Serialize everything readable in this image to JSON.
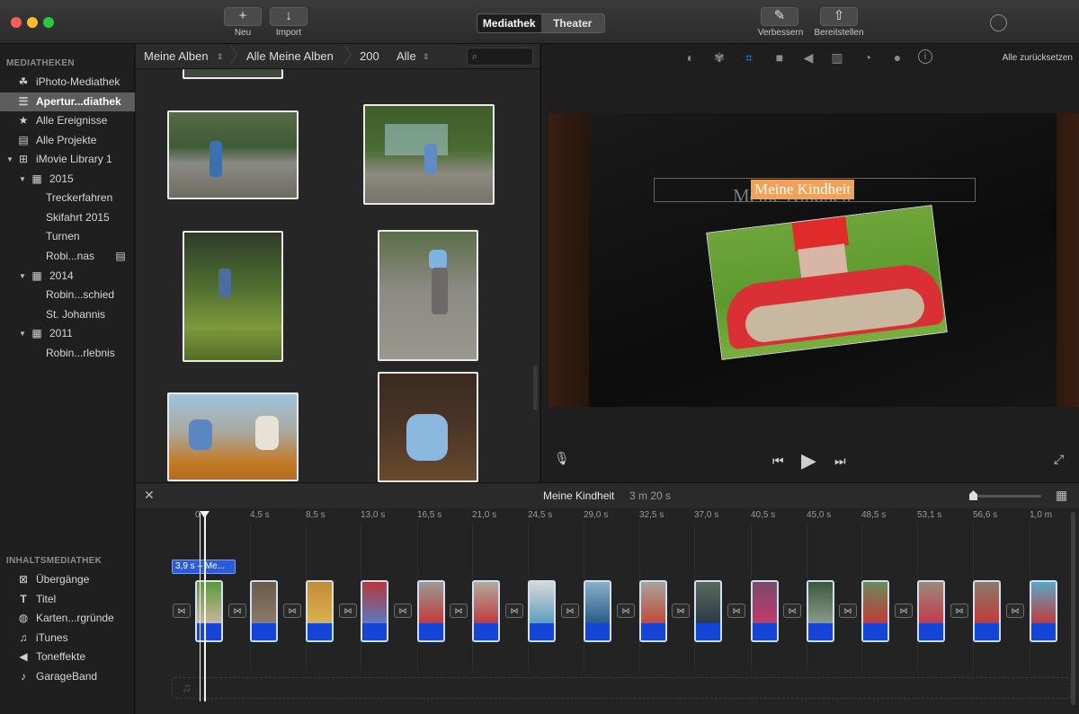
{
  "toolbar": {
    "new_label": "Neu",
    "import_label": "Import",
    "tabs": [
      "Mediathek",
      "Theater"
    ],
    "enhance_label": "Verbessern",
    "share_label": "Bereitstellen"
  },
  "sidebar": {
    "libraries_header": "MEDIATHEKEN",
    "items": [
      {
        "label": "iPhoto-Mediathek",
        "icon": "palm-tree-icon"
      },
      {
        "label": "Apertur...diathek",
        "icon": "aperture-library-icon"
      },
      {
        "label": "Alle Ereignisse",
        "icon": "star-icon"
      },
      {
        "label": "Alle Projekte",
        "icon": "clapperboard-icon"
      },
      {
        "label": "iMovie Library 1",
        "icon": "grid-icon"
      },
      {
        "label": "2015",
        "icon": "calendar-icon"
      },
      {
        "label": "Treckerfahren"
      },
      {
        "label": "Skifahrt 2015"
      },
      {
        "label": "Turnen"
      },
      {
        "label": "Robi...nas",
        "icon": "clapperboard-icon"
      },
      {
        "label": "2014",
        "icon": "calendar-icon"
      },
      {
        "label": "Robin...schied"
      },
      {
        "label": "St. Johannis"
      },
      {
        "label": "2011",
        "icon": "calendar-icon"
      },
      {
        "label": "Robin...rlebnis"
      }
    ],
    "content_header": "INHALTSMEDIATHEK",
    "content_items": [
      {
        "label": "Übergänge",
        "icon": "transitions-icon"
      },
      {
        "label": "Titel",
        "icon": "title-t-icon"
      },
      {
        "label": "Karten...rgründe",
        "icon": "globe-icon"
      },
      {
        "label": "iTunes",
        "icon": "music-note-icon"
      },
      {
        "label": "Toneffekte",
        "icon": "speaker-icon"
      },
      {
        "label": "GarageBand",
        "icon": "guitar-icon"
      }
    ]
  },
  "browser": {
    "crumb1": "Meine Alben",
    "crumb2": "Alle Meine Alben",
    "crumb3": "200",
    "filter": "Alle"
  },
  "viewer": {
    "reset_all": "Alle zurücksetzen",
    "title_text": "Meine Kindheit",
    "title_ghost": "Meine Kindheit"
  },
  "timeline": {
    "project_name": "Meine Kindheit",
    "duration": "3 m 20 s",
    "clip_tag": "3,9 s – Me...",
    "ticks": [
      "0",
      "4,5 s",
      "8,5 s",
      "13,0 s",
      "16,5 s",
      "21,0 s",
      "24,5 s",
      "29,0 s",
      "32,5 s",
      "37,0 s",
      "40,5 s",
      "45,0 s",
      "48,5 s",
      "53,1 s",
      "56,6 s",
      "1,0 m"
    ]
  }
}
